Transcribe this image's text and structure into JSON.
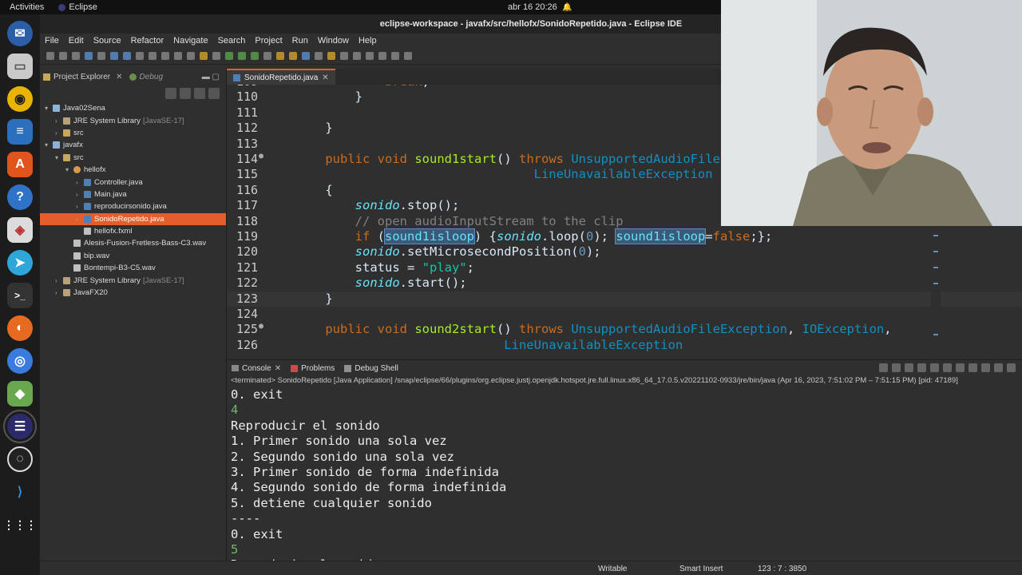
{
  "topbar": {
    "activities": "Activities",
    "app": "Eclipse",
    "clock": "abr 16  20:26"
  },
  "window": {
    "title": "eclipse-workspace - javafx/src/hellofx/SonidoRepetido.java - Eclipse IDE"
  },
  "menu": [
    "File",
    "Edit",
    "Source",
    "Refactor",
    "Navigate",
    "Search",
    "Project",
    "Run",
    "Window",
    "Help"
  ],
  "explorer": {
    "tab_project": "Project Explorer",
    "tab_debug": "Debug",
    "tree": [
      {
        "label": "Java02Sena",
        "extra": "",
        "indent": 0,
        "twisty": "▾",
        "icon": "proj"
      },
      {
        "label": "JRE System Library",
        "extra": "[JavaSE-17]",
        "indent": 1,
        "twisty": "›",
        "icon": "lib"
      },
      {
        "label": "src",
        "extra": "",
        "indent": 1,
        "twisty": "›",
        "icon": "src"
      },
      {
        "label": "javafx",
        "extra": "",
        "indent": 0,
        "twisty": "▾",
        "icon": "proj"
      },
      {
        "label": "src",
        "extra": "",
        "indent": 1,
        "twisty": "▾",
        "icon": "src"
      },
      {
        "label": "hellofx",
        "extra": "",
        "indent": 2,
        "twisty": "▾",
        "icon": "pkg"
      },
      {
        "label": "Controller.java",
        "extra": "",
        "indent": 3,
        "twisty": "›",
        "icon": "java"
      },
      {
        "label": "Main.java",
        "extra": "",
        "indent": 3,
        "twisty": "›",
        "icon": "java"
      },
      {
        "label": "reproducirsonido.java",
        "extra": "",
        "indent": 3,
        "twisty": "›",
        "icon": "java"
      },
      {
        "label": "SonidoRepetido.java",
        "extra": "",
        "indent": 3,
        "twisty": "›",
        "icon": "java",
        "selected": true
      },
      {
        "label": "hellofx.fxml",
        "extra": "",
        "indent": 3,
        "twisty": "",
        "icon": "file"
      },
      {
        "label": "Alesis-Fusion-Fretless-Bass-C3.wav",
        "extra": "",
        "indent": 2,
        "twisty": "",
        "icon": "file"
      },
      {
        "label": "bip.wav",
        "extra": "",
        "indent": 2,
        "twisty": "",
        "icon": "file"
      },
      {
        "label": "Bontempi-B3-C5.wav",
        "extra": "",
        "indent": 2,
        "twisty": "",
        "icon": "file"
      },
      {
        "label": "JRE System Library",
        "extra": "[JavaSE-17]",
        "indent": 1,
        "twisty": "›",
        "icon": "lib"
      },
      {
        "label": "JavaFX20",
        "extra": "",
        "indent": 1,
        "twisty": "›",
        "icon": "lib"
      }
    ]
  },
  "editor": {
    "tab": "SonidoRepetido.java",
    "lines": [
      {
        "n": "109",
        "fold": "",
        "html": "            <span class='kw'>break</span>;"
      },
      {
        "n": "110",
        "fold": "",
        "html": "        }"
      },
      {
        "n": "111",
        "fold": "",
        "html": ""
      },
      {
        "n": "112",
        "fold": "",
        "html": "    }"
      },
      {
        "n": "113",
        "fold": "",
        "html": ""
      },
      {
        "n": "114",
        "fold": "●",
        "html": "    <span class='kw'>public</span> <span class='kw'>void</span> <span class='fn'>sound1start</span>() <span class='kw'>throws</span> <span class='ty'>UnsupportedAudioFileExce</span>"
      },
      {
        "n": "115",
        "fold": "",
        "html": "                                <span class='ty'>LineUnavailableException</span>"
      },
      {
        "n": "116",
        "fold": "",
        "html": "    {"
      },
      {
        "n": "117",
        "fold": "",
        "html": "        <span class='fld'>sonido</span>.stop();"
      },
      {
        "n": "118",
        "fold": "",
        "html": "        <span class='cmt'>// open audioInputStream to the clip</span>"
      },
      {
        "n": "119",
        "fold": "",
        "html": "        <span class='kw'>if</span> (<span class='hl'>sound1isloop</span>) {<span class='fld'>sonido</span>.loop(<span class='num'>0</span>); <span class='hl'>sound1isloop</span>=<span class='kw'>false</span>;};"
      },
      {
        "n": "120",
        "fold": "",
        "html": "        <span class='fld'>sonido</span>.setMicrosecondPosition(<span class='num'>0</span>);"
      },
      {
        "n": "121",
        "fold": "",
        "html": "        status = <span class='str'>\"play\"</span>;"
      },
      {
        "n": "122",
        "fold": "",
        "html": "        <span class='fld'>sonido</span>.start();"
      },
      {
        "n": "123",
        "fold": "",
        "html": "    }",
        "current": true
      },
      {
        "n": "124",
        "fold": "",
        "html": ""
      },
      {
        "n": "125",
        "fold": "●",
        "html": "    <span class='kw'>public</span> <span class='kw'>void</span> <span class='fn'>sound2start</span>() <span class='kw'>throws</span> <span class='ty'>UnsupportedAudioFileException</span>, <span class='ty'>IOException</span>,"
      },
      {
        "n": "126",
        "fold": "",
        "html": "                            <span class='ty'>LineUnavailableException</span>"
      }
    ]
  },
  "console": {
    "tab_console": "Console",
    "tab_problems": "Problems",
    "tab_debugshell": "Debug Shell",
    "terminated": "<terminated> SonidoRepetido [Java Application] /snap/eclipse/66/plugins/org.eclipse.justj.openjdk.hotspot.jre.full.linux.x86_64_17.0.5.v20221102-0933/jre/bin/java  (Apr 16, 2023, 7:51:02 PM – 7:51:15 PM) [pid: 47189]",
    "lines": [
      {
        "t": "0. exit",
        "input": false
      },
      {
        "t": "4",
        "input": true
      },
      {
        "t": "Reproducir el sonido",
        "input": false
      },
      {
        "t": "1. Primer sonido una sola vez",
        "input": false
      },
      {
        "t": "2. Segundo sonido una sola vez",
        "input": false
      },
      {
        "t": "3. Primer sonido de forma indefinida",
        "input": false
      },
      {
        "t": "4. Segundo sonido de forma indefinida",
        "input": false
      },
      {
        "t": "5. detiene cualquier sonido",
        "input": false
      },
      {
        "t": "----",
        "input": false
      },
      {
        "t": "0. exit",
        "input": false
      },
      {
        "t": "5",
        "input": true
      },
      {
        "t": "Reproducir el sonido",
        "input": false
      }
    ]
  },
  "status": {
    "writable": "Writable",
    "insert": "Smart Insert",
    "position": "123 : 7 : 3850"
  }
}
